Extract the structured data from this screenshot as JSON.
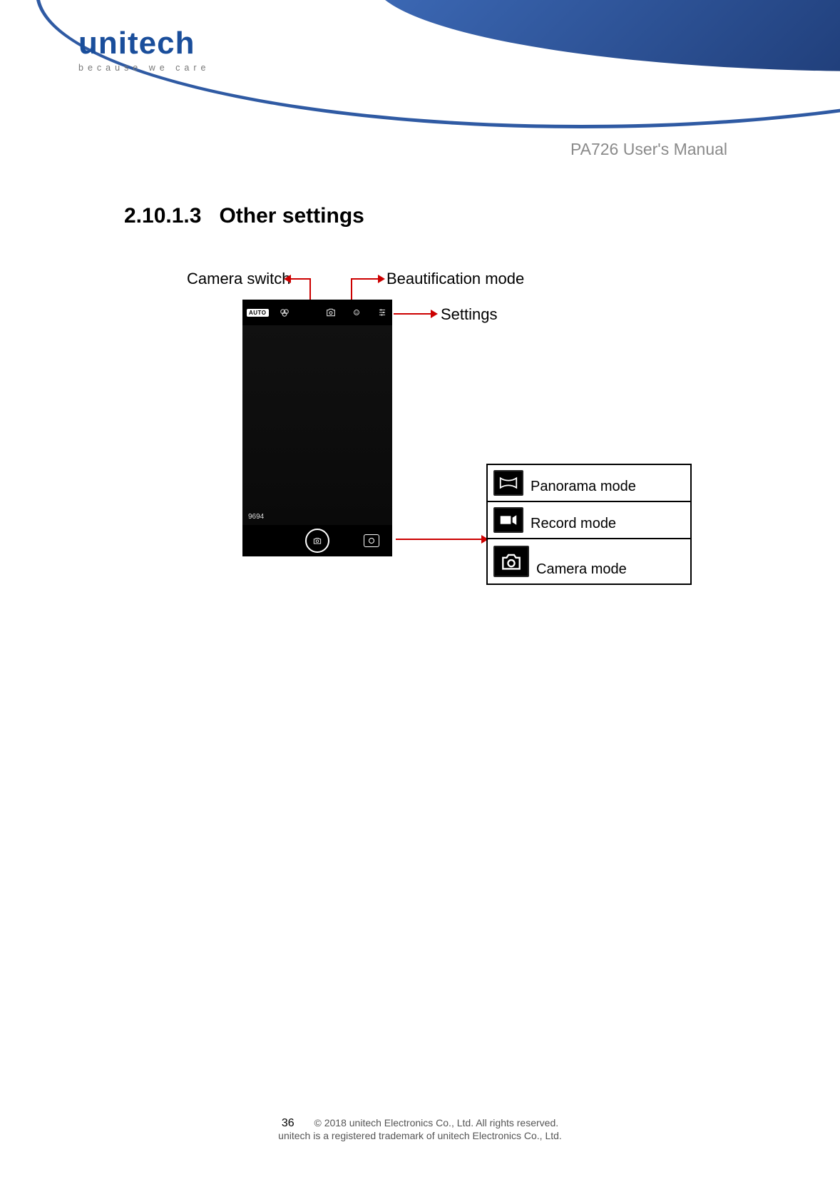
{
  "header": {
    "logo_word": "unitech",
    "logo_tagline": "because we care",
    "doc_title": "PA726 User's Manual"
  },
  "section": {
    "number": "2.10.1.3",
    "title": "Other settings"
  },
  "labels": {
    "camera_switch": "Camera switch",
    "beautification": "Beautification mode",
    "settings": "Settings"
  },
  "phone": {
    "auto_badge": "AUTO",
    "resolution": "9694"
  },
  "legend": [
    {
      "name": "panorama",
      "label": "Panorama mode"
    },
    {
      "name": "record",
      "label": "Record mode"
    },
    {
      "name": "camera",
      "label": "Camera mode"
    }
  ],
  "footer": {
    "page_number": "36",
    "copyright": "© 2018 unitech Electronics Co., Ltd. All rights reserved.",
    "trademark": "unitech is a registered trademark of unitech Electronics Co., Ltd."
  }
}
